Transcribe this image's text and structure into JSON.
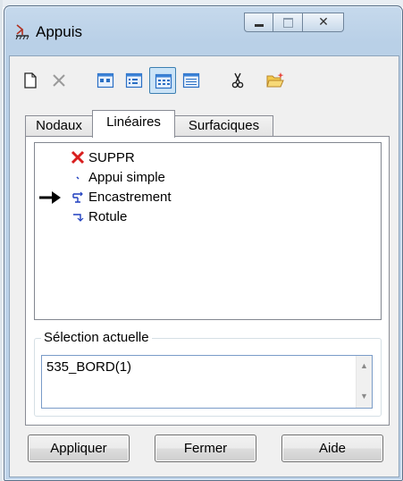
{
  "window": {
    "title": "Appuis",
    "caption_buttons": {
      "close_glyph": "✕"
    }
  },
  "toolbar": {
    "buttons": [
      {
        "name": "new-document-icon",
        "pressed": false
      },
      {
        "name": "delete-x-icon",
        "pressed": false
      },
      {
        "name": "view-large-icons-icon",
        "pressed": false
      },
      {
        "name": "view-small-icons-icon",
        "pressed": false
      },
      {
        "name": "view-list-icon",
        "pressed": true
      },
      {
        "name": "view-details-icon",
        "pressed": false
      },
      {
        "name": "scissors-icon",
        "pressed": false
      },
      {
        "name": "open-folder-icon",
        "pressed": false
      }
    ]
  },
  "tabs": [
    {
      "label": "Nodaux",
      "active": false
    },
    {
      "label": "Linéaires",
      "active": true
    },
    {
      "label": "Surfaciques",
      "active": false
    }
  ],
  "support_list": {
    "items": [
      {
        "label": "SUPPR",
        "icon": "delete-red-x-icon",
        "current": false
      },
      {
        "label": "Appui simple",
        "icon": "simple-support-icon",
        "current": false
      },
      {
        "label": "Encastrement",
        "icon": "fixed-support-icon",
        "current": true
      },
      {
        "label": "Rotule",
        "icon": "hinge-icon",
        "current": false
      }
    ]
  },
  "selection": {
    "legend": "Sélection actuelle",
    "value": "535_BORD(1)"
  },
  "buttons": {
    "apply_label": "Appliquer",
    "close_label": "Fermer",
    "help_label": "Aide"
  },
  "colors": {
    "accent_pressed": "#cce4f7",
    "delete_red": "#d81e1e",
    "support_blue": "#1f3fbf"
  }
}
